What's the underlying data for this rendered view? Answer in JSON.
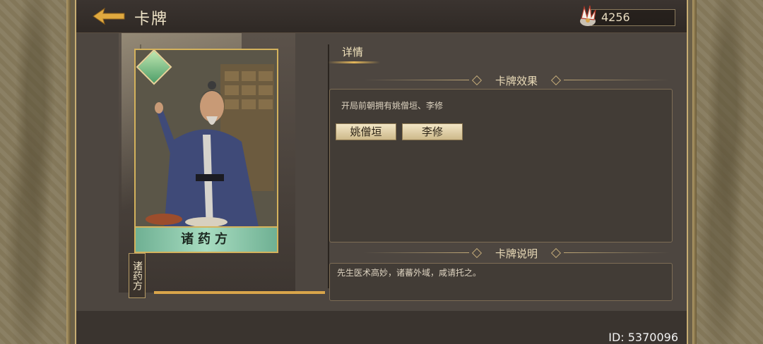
{
  "header": {
    "title": "卡牌",
    "currency_value": "4256"
  },
  "card": {
    "name": "诸药方",
    "vertical_label": "诸药方",
    "progress_fraction": 1.0
  },
  "tabs": [
    {
      "label": "详情",
      "active": true
    }
  ],
  "effect_section": {
    "title": "卡牌效果",
    "text": "开局前朝拥有姚僧垣、李修",
    "chips": [
      "姚僧垣",
      "李修"
    ]
  },
  "description_section": {
    "title": "卡牌说明",
    "text": "先生医术高妙，诸蕃外域，咸请托之。"
  },
  "footer": {
    "id_text": "ID: 5370096"
  },
  "colors": {
    "accent_gold": "#d4b25c",
    "frame_bg": "#4a433d",
    "banner_green": "#a7dcc0"
  },
  "icons": [
    "back-arrow-icon",
    "feather-currency-icon",
    "card-gem-icon"
  ]
}
